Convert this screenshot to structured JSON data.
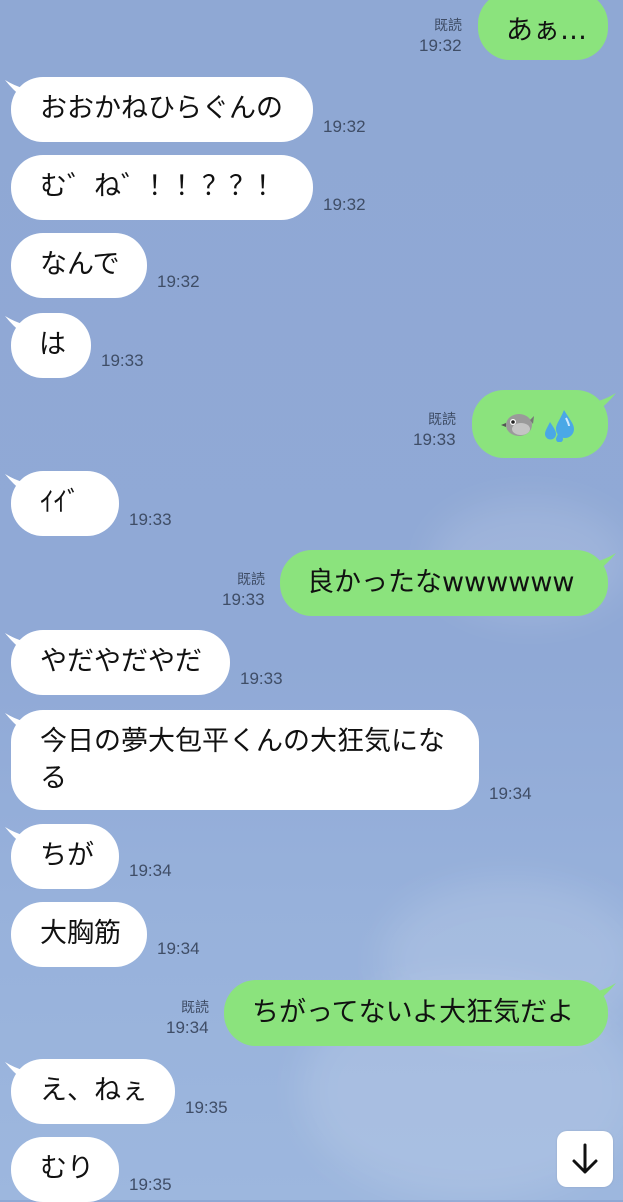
{
  "read_label": "既読",
  "messages": [
    {
      "side": "out",
      "text": "あぁ…",
      "time": "19:32",
      "read": true
    },
    {
      "side": "in",
      "text": "おおかねひらぐんの",
      "time": "19:32"
    },
    {
      "side": "in",
      "text": "む゛ね゛！！？？！",
      "time": "19:32"
    },
    {
      "side": "in",
      "text": "なんで",
      "time": "19:32"
    },
    {
      "side": "in",
      "text": "は",
      "time": "19:33"
    },
    {
      "side": "out",
      "emoji": [
        "bird-emoji",
        "sweat-droplets-emoji"
      ],
      "time": "19:33",
      "read": true
    },
    {
      "side": "in",
      "text": "ｲｲﾞ",
      "time": "19:33"
    },
    {
      "side": "out",
      "text": "良かったなwwwwww",
      "time": "19:33",
      "read": true
    },
    {
      "side": "in",
      "text": "やだやだやだ",
      "time": "19:33"
    },
    {
      "side": "in",
      "text_line1": "今日の夢大包平くんの大狂気にな",
      "text_line2": "る",
      "time": "19:34"
    },
    {
      "side": "in",
      "text": "ちが",
      "time": "19:34"
    },
    {
      "side": "in",
      "text": "大胸筋",
      "time": "19:34"
    },
    {
      "side": "out",
      "text": "ちがってないよ大狂気だよ",
      "time": "19:34",
      "read": true
    },
    {
      "side": "in",
      "text": "え、ねぇ",
      "time": "19:35"
    },
    {
      "side": "in",
      "text": "むり",
      "time": "19:35"
    }
  ],
  "scroll_button": {
    "icon": "arrow-down-icon"
  }
}
